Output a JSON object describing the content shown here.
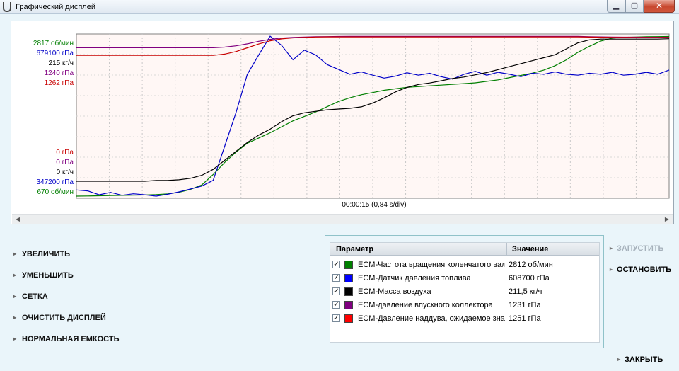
{
  "window": {
    "title": "Графический дисплей",
    "controls": {
      "minimize": "▁",
      "maximize": "▢",
      "close": "✕"
    }
  },
  "chart": {
    "time_label": "00:00:15 (0,84 s/div)",
    "scrollbar": {
      "left_arrow": "◀",
      "right_arrow": "▶"
    }
  },
  "chart_data": {
    "type": "line",
    "grid": true,
    "x_divisions": 18,
    "x_step_s": 0.84,
    "series": [
      {
        "name": "ECM-Частота вращения коленчатого вала",
        "color": "#007f00",
        "max_label": "2817 об/мин",
        "min_label": "670 об/мин",
        "min": 670,
        "max": 2817,
        "values": [
          670,
          672,
          675,
          678,
          680,
          682,
          685,
          690,
          700,
          720,
          760,
          820,
          960,
          1120,
          1260,
          1380,
          1450,
          1520,
          1600,
          1680,
          1740,
          1800,
          1870,
          1940,
          1990,
          2030,
          2060,
          2090,
          2110,
          2130,
          2140,
          2150,
          2160,
          2170,
          2180,
          2190,
          2210,
          2230,
          2260,
          2290,
          2320,
          2360,
          2420,
          2500,
          2600,
          2680,
          2750,
          2790,
          2800,
          2805,
          2808,
          2810,
          2812
        ]
      },
      {
        "name": "ECM-Датчик давления топлива",
        "color": "#0000c8",
        "max_label": "679100 гПа",
        "min_label": "347200 гПа",
        "min": 347200,
        "max": 679100,
        "values": [
          360000,
          358000,
          350000,
          355000,
          349000,
          352000,
          350000,
          347200,
          351000,
          356000,
          362000,
          368000,
          380000,
          450000,
          520000,
          600000,
          640000,
          679000,
          660000,
          630000,
          650000,
          640000,
          620000,
          610000,
          600000,
          605000,
          598000,
          592000,
          596000,
          603000,
          598000,
          602000,
          595000,
          590000,
          600000,
          606000,
          598000,
          604000,
          600000,
          595000,
          602000,
          600000,
          605000,
          600000,
          598000,
          602000,
          600000,
          604000,
          598000,
          600000,
          604000,
          600000,
          608700
        ]
      },
      {
        "name": "ECM-Масса воздуха",
        "color": "#000000",
        "max_label": "215 кг/ч",
        "min_label": "0 кг/ч",
        "min": 0,
        "max": 215,
        "values": [
          20,
          20,
          20,
          20,
          20,
          20,
          20,
          21,
          21,
          22,
          24,
          28,
          36,
          48,
          60,
          72,
          82,
          90,
          100,
          108,
          112,
          114,
          116,
          117,
          118,
          120,
          125,
          132,
          140,
          146,
          150,
          152,
          155,
          158,
          160,
          163,
          166,
          170,
          174,
          178,
          182,
          186,
          190,
          198,
          206,
          210,
          211,
          211,
          211,
          211,
          211,
          211,
          211.5
        ]
      },
      {
        "name": "ECM-давление впускного коллектора",
        "color": "#800080",
        "max_label": "1240 гПа",
        "min_label": "0 гПа",
        "min": 0,
        "max": 1240,
        "values": [
          1150,
          1150,
          1150,
          1150,
          1150,
          1150,
          1150,
          1150,
          1150,
          1150,
          1150,
          1150,
          1150,
          1155,
          1165,
          1180,
          1200,
          1215,
          1225,
          1230,
          1233,
          1235,
          1236,
          1237,
          1238,
          1238,
          1238,
          1238,
          1238,
          1238,
          1238,
          1238,
          1238,
          1238,
          1238,
          1238,
          1238,
          1238,
          1238,
          1238,
          1238,
          1238,
          1238,
          1238,
          1238,
          1235,
          1234,
          1233,
          1232,
          1232,
          1231,
          1231,
          1231
        ]
      },
      {
        "name": "ECM-Давление наддува, ожидаемое значение",
        "color": "#c80000",
        "max_label": "1262 гПа",
        "min_label": "0 гПа",
        "min": 0,
        "max": 1262,
        "values": [
          1110,
          1110,
          1110,
          1110,
          1110,
          1110,
          1110,
          1110,
          1110,
          1110,
          1110,
          1110,
          1110,
          1120,
          1140,
          1170,
          1200,
          1225,
          1240,
          1248,
          1252,
          1255,
          1256,
          1256,
          1256,
          1256,
          1256,
          1256,
          1256,
          1256,
          1256,
          1256,
          1256,
          1256,
          1256,
          1256,
          1256,
          1256,
          1256,
          1256,
          1256,
          1256,
          1256,
          1256,
          1256,
          1254,
          1253,
          1252,
          1252,
          1251,
          1251,
          1251,
          1251
        ]
      }
    ]
  },
  "actions": {
    "zoom_in": "УВЕЛИЧИТЬ",
    "zoom_out": "УМЕНЬШИТЬ",
    "grid": "СЕТКА",
    "clear": "ОЧИСТИТЬ ДИСПЛЕЙ",
    "normal_capacity": "НОРМАЛЬНАЯ ЕМКОСТЬ"
  },
  "legend": {
    "headers": {
      "param": "Параметр",
      "value": "Значение"
    },
    "rows": [
      {
        "checked": "✓",
        "color": "#008000",
        "name": "ECM-Частота вращения коленчатого вала",
        "value": "2812 об/мин"
      },
      {
        "checked": "✓",
        "color": "#0000ff",
        "name": "ECM-Датчик давления топлива",
        "value": "608700 гПа"
      },
      {
        "checked": "✓",
        "color": "#000000",
        "name": "ECM-Масса воздуха",
        "value": "211,5 кг/ч"
      },
      {
        "checked": "✓",
        "color": "#800080",
        "name": "ECM-давление впускного коллектора",
        "value": "1231 гПа"
      },
      {
        "checked": "✓",
        "color": "#ff0000",
        "name": "ECM-Давление наддува, ожидаемое значение",
        "value": "1251 гПа"
      }
    ]
  },
  "controls": {
    "start": "ЗАПУСТИТЬ",
    "stop": "ОСТАНОВИТЬ",
    "close": "ЗАКРЫТЬ"
  }
}
